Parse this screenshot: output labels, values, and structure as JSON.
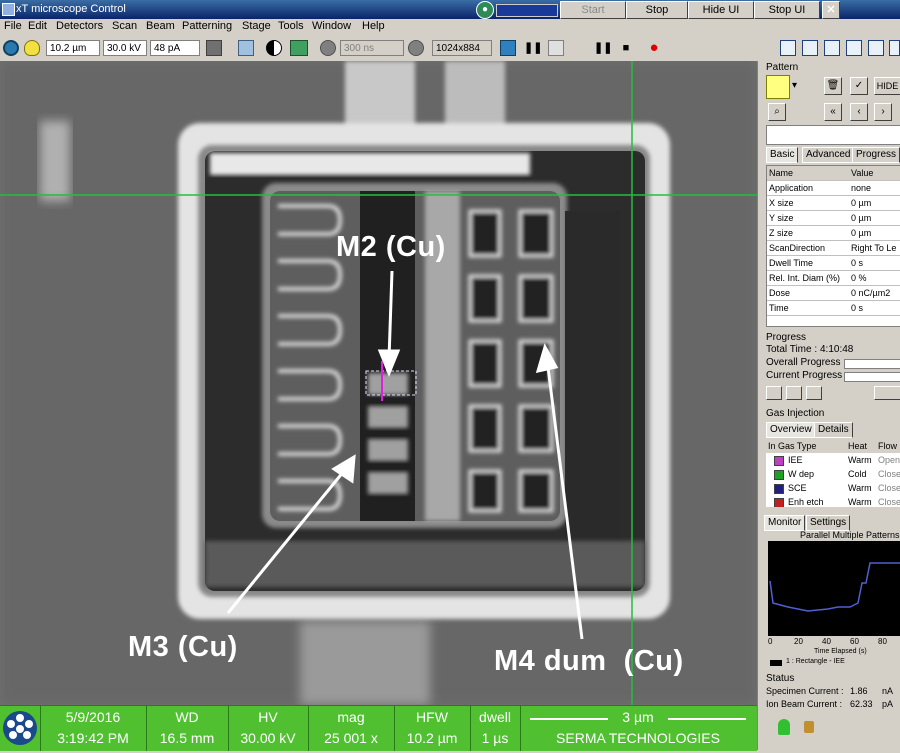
{
  "window": {
    "title": "xT microscope Control",
    "buttons": {
      "start": "Start",
      "stop": "Stop",
      "hide_ui": "Hide UI",
      "stop_ui": "Stop UI",
      "close": "✕"
    }
  },
  "menu": [
    "File",
    "Edit",
    "Detectors",
    "Scan",
    "Beam",
    "Patterning",
    "Stage",
    "Tools",
    "Window",
    "Help"
  ],
  "toolbar": {
    "hfw": "10.2 µm",
    "hv": "30.0 kV",
    "current": "48 pA",
    "dwell_disabled": "300 ns",
    "resolution": "1024x884"
  },
  "annotations": {
    "m2": "M2 (Cu)",
    "m3": "M3 (Cu)",
    "m4": "M4 dum  (Cu)"
  },
  "statusbar": {
    "date": "5/9/2016",
    "time": "3:19:42 PM",
    "wd_label": "WD",
    "wd_value": "16.5 mm",
    "hv_label": "HV",
    "hv_value": "30.00 kV",
    "mag_label": "mag",
    "mag_value": "25 001 x",
    "hfw_label": "HFW",
    "hfw_value": "10.2 µm",
    "dwell_label": "dwell",
    "dwell_value": "1 µs",
    "scalebar": "3 µm",
    "company": "SERMA TECHNOLOGIES"
  },
  "panel": {
    "pattern_title": "Pattern",
    "hide_label": "HIDE",
    "tabs": [
      "Basic",
      "Advanced",
      "Progress"
    ],
    "table_headers": [
      "Name",
      "Value"
    ],
    "properties": [
      {
        "name": "Application",
        "value": "none"
      },
      {
        "name": "X size",
        "value": "0 µm"
      },
      {
        "name": "Y size",
        "value": "0 µm"
      },
      {
        "name": "Z size",
        "value": "0 µm"
      },
      {
        "name": "ScanDirection",
        "value": "Right To Le"
      },
      {
        "name": "Dwell Time",
        "value": "0 s"
      },
      {
        "name": "Rel. Int. Diam (%)",
        "value": "0 %"
      },
      {
        "name": "Dose",
        "value": "0 nC/µm2"
      },
      {
        "name": "Time",
        "value": "0 s"
      }
    ],
    "progress_title": "Progress",
    "total_time_label": "Total Time :",
    "total_time_value": "4:10:48",
    "overall_progress": "Overall Progress",
    "current_progress": "Current Progress",
    "gas_title": "Gas Injection",
    "gas_tabs": [
      "Overview",
      "Details"
    ],
    "gas_headers": [
      "In Gas Type",
      "Heat",
      "Flow"
    ],
    "gases": [
      {
        "name": "IEE",
        "heat": "Warm",
        "flow": "Open",
        "color": "#c040c0"
      },
      {
        "name": "W dep",
        "heat": "Cold",
        "flow": "Close",
        "color": "#20a020"
      },
      {
        "name": "SCE",
        "heat": "Warm",
        "flow": "Close",
        "color": "#202080"
      },
      {
        "name": "Enh etch",
        "heat": "Warm",
        "flow": "Close",
        "color": "#c02020"
      }
    ],
    "monitor_tabs": [
      "Monitor",
      "Settings"
    ],
    "monitor_title": "Parallel Multiple Patterns",
    "monitor_xticks": [
      "0",
      "20",
      "40",
      "60",
      "80"
    ],
    "monitor_xlabel": "Time Elapsed (s)",
    "monitor_legend": "1 : Rectangle - IEE",
    "status_title": "Status",
    "specimen_current_label": "Specimen Current :",
    "specimen_current_value": "1.86",
    "specimen_current_unit": "nA",
    "ion_beam_current_label": "Ion Beam Current :",
    "ion_beam_current_value": "62.33",
    "ion_beam_current_unit": "pA"
  }
}
